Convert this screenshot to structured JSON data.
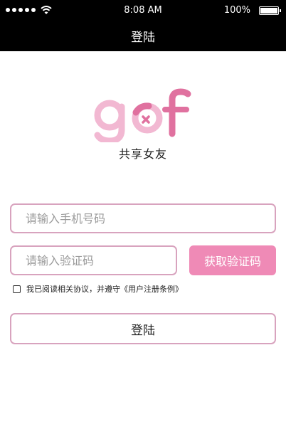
{
  "status_bar": {
    "time": "8:08 AM",
    "battery_percent": "100%",
    "battery_level": 1.0,
    "signal_icon": "signal-dots-icon",
    "wifi_icon": "wifi-icon",
    "battery_icon": "battery-icon"
  },
  "nav": {
    "title": "登陆"
  },
  "logo": {
    "text": "gof",
    "slogan": "共享女友",
    "colors": {
      "light_pink": "#f2b8d2",
      "dark_pink": "#e0719f"
    }
  },
  "form": {
    "phone_placeholder": "请输入手机号码",
    "phone_value": "",
    "code_placeholder": "请输入验证码",
    "code_value": "",
    "get_code_label": "获取验证码",
    "agreement_text": "我已阅读相关协议，并遵守《用户注册条例》",
    "agreement_checked": false,
    "login_label": "登陆"
  },
  "colors": {
    "accent": "#ef8ab6",
    "border": "#d8a3be",
    "header": "#000000"
  }
}
